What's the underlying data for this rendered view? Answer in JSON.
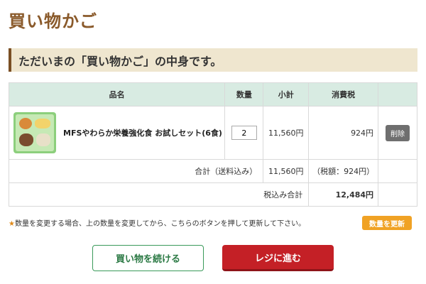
{
  "page": {
    "title": "買い物かご",
    "heading": "ただいまの「買い物かご」の中身です。"
  },
  "table": {
    "headers": [
      "品名",
      "数量",
      "小計",
      "消費税",
      ""
    ],
    "items": [
      {
        "name": "MFSやわらか栄養強化食 お試しセット(6食)",
        "quantity": "2",
        "subtotal": "11,560円",
        "tax": "924円",
        "delete_label": "削除"
      }
    ],
    "total": {
      "label": "合計（送料込み）",
      "amount": "11,560円",
      "tax": "（税額：924円）"
    },
    "grand_total": {
      "label": "税込み合計",
      "amount": "12,484円"
    }
  },
  "note": {
    "star": "★",
    "text": "数量を変更する場合、上の数量を変更してから、こちらのボタンを押して更新して下さい。"
  },
  "buttons": {
    "update": "数量を更新",
    "continue": "買い物を続ける",
    "checkout": "レジに進む"
  },
  "colors": {
    "title": "#8a5a2b",
    "heading_bg": "#efe6cf",
    "table_header_bg": "#d8ebe2",
    "update": "#f0a224",
    "continue_border": "#3a9a5a",
    "checkout": "#c42026"
  }
}
